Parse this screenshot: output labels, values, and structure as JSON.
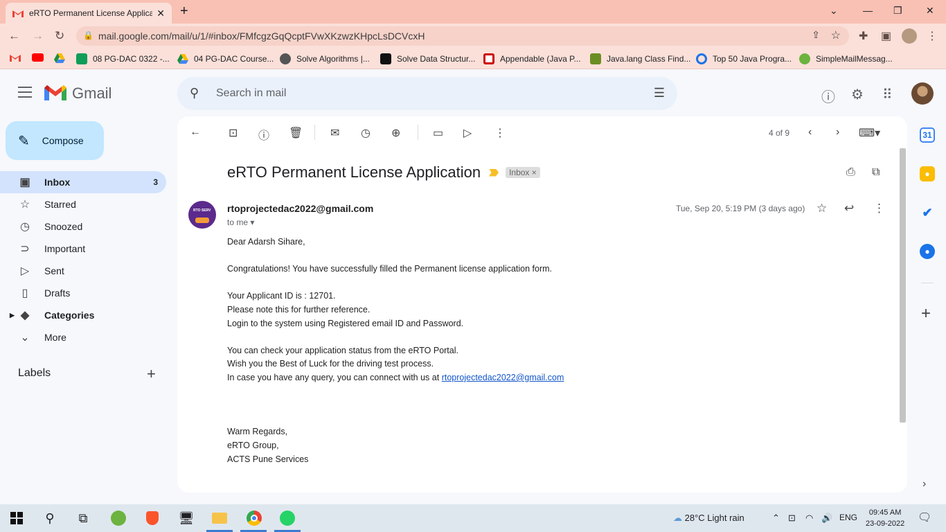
{
  "browser": {
    "tab_title": "eRTO Permanent License Applicati",
    "new_tab": "+",
    "url": "mail.google.com/mail/u/1/#inbox/FMfcgzGqQcptFVwXKzwzKHpcLsDCVcxH",
    "bookmarks": [
      {
        "label": "08 PG-DAC 0322 -..."
      },
      {
        "label": "04 PG-DAC Course..."
      },
      {
        "label": "Solve Algorithms |..."
      },
      {
        "label": "Solve Data Structur..."
      },
      {
        "label": "Appendable (Java P..."
      },
      {
        "label": "Java.lang Class Find..."
      },
      {
        "label": "Top 50 Java Progra..."
      },
      {
        "label": "SimpleMailMessag..."
      }
    ]
  },
  "gmail": {
    "brand": "Gmail",
    "search_placeholder": "Search in mail",
    "compose_label": "Compose",
    "nav": [
      {
        "label": "Inbox",
        "count": "3",
        "icon": "inbox-icon"
      },
      {
        "label": "Starred",
        "icon": "star-icon"
      },
      {
        "label": "Snoozed",
        "icon": "clock-icon"
      },
      {
        "label": "Important",
        "icon": "important-icon"
      },
      {
        "label": "Sent",
        "icon": "send-icon"
      },
      {
        "label": "Drafts",
        "icon": "draft-icon"
      },
      {
        "label": "Categories",
        "icon": "label-icon"
      },
      {
        "label": "More",
        "icon": "chevron-down-icon"
      }
    ],
    "labels_heading": "Labels",
    "pager": "4 of 9"
  },
  "email": {
    "subject": "eRTO Permanent License Application",
    "inbox_chip": "Inbox ×",
    "sender": "rtoprojectedac2022@gmail.com",
    "to_me": "to me",
    "date": "Tue, Sep 20, 5:19 PM (3 days ago)",
    "body": {
      "greeting": "Dear Adarsh Sihare,",
      "line1": "Congratulations! You have successfully filled the Permanent license application form.",
      "line2": "Your Applicant ID is : 12701.",
      "line3": "Please note this for further reference.",
      "line4": "Login to the system using Registered email ID and Password.",
      "line5": "You can check your application status from the eRTO Portal.",
      "line6": "Wish you the Best of Luck for the driving test process.",
      "line7_prefix": "In case you have any query, you can connect with us at ",
      "line7_link": "rtoprojectedac2022@gmail.com",
      "sign1": "Warm Regards,",
      "sign2": "eRTO Group,",
      "sign3": "ACTS Pune Services"
    }
  },
  "taskbar": {
    "weather": "28°C  Light rain",
    "lang": "ENG",
    "time": "09:45 AM",
    "date": "23-09-2022"
  },
  "colors": {
    "accent_compose": "#c2e7ff",
    "inbox_active": "#d3e3fd",
    "browser_frame": "#f8c1b4",
    "link": "#1155cc"
  }
}
